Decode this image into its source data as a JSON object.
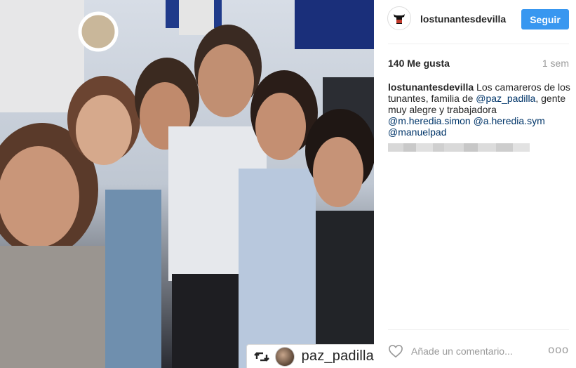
{
  "post": {
    "photo_alt": "group selfie photo",
    "repost_username": "paz_padilla"
  },
  "header": {
    "username": "lostunantesdevilla",
    "follow_label": "Seguir"
  },
  "stats": {
    "likes": "140 Me gusta",
    "time_ago": "1 sem"
  },
  "caption": {
    "author": "lostunantesdevilla",
    "text1": " Los camareros de los tunantes, familia de ",
    "mention1": "@paz_padilla",
    "text2": ", gente muy alegre y trabajadora ",
    "mention2": "@m.heredia.simon",
    "text3": " ",
    "mention3": "@a.heredia.sym",
    "text4": " ",
    "mention4": "@manuelpad"
  },
  "comment": {
    "placeholder": "Añade un comentario...",
    "more_label": "ooo"
  },
  "colors": {
    "accent": "#3897f0",
    "mention": "#003569",
    "muted": "#999999"
  }
}
